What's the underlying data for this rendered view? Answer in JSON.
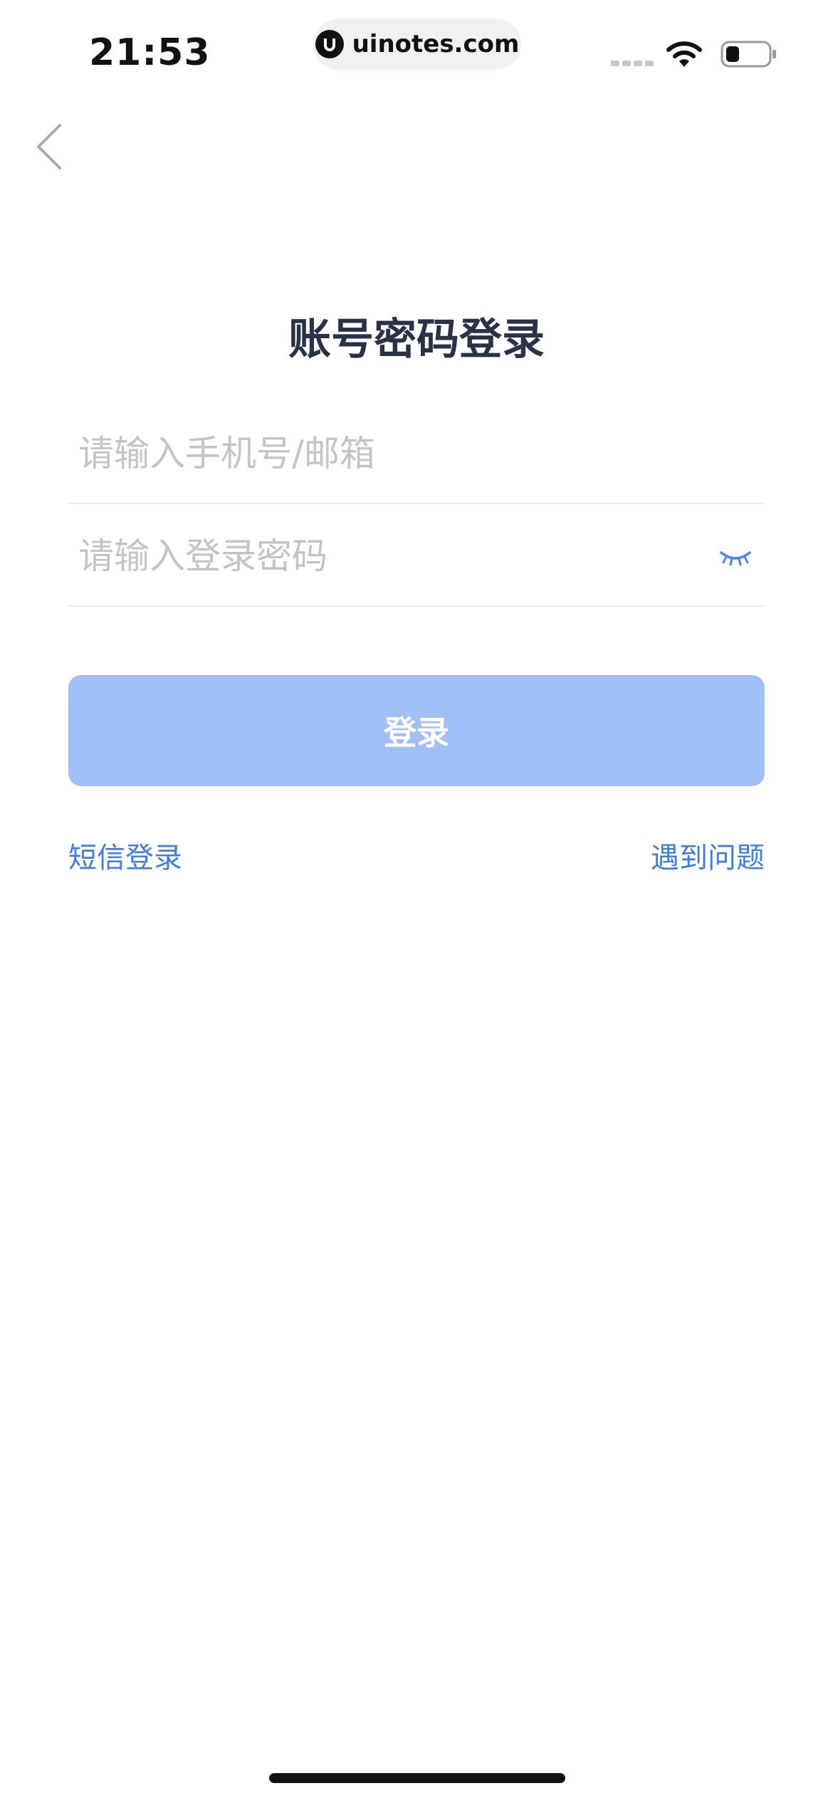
{
  "status_bar": {
    "time": "21:53",
    "watermark": "uinotes.com",
    "icons": [
      "signal-icon",
      "wifi-icon",
      "battery-icon"
    ]
  },
  "nav": {
    "back_icon": "chevron-left-icon"
  },
  "title": "账号密码登录",
  "form": {
    "account_placeholder": "请输入手机号/邮箱",
    "account_value": "",
    "password_placeholder": "请输入登录密码",
    "password_value": "",
    "password_toggle_icon": "eye-closed-icon"
  },
  "login_button": "登录",
  "links": {
    "sms_login": "短信登录",
    "help": "遇到问题"
  },
  "colors": {
    "title": "#2a3248",
    "accent": "#3f7ede",
    "button_bg": "#a0bff7",
    "placeholder": "#c4c4c4",
    "divider": "#ececec"
  }
}
